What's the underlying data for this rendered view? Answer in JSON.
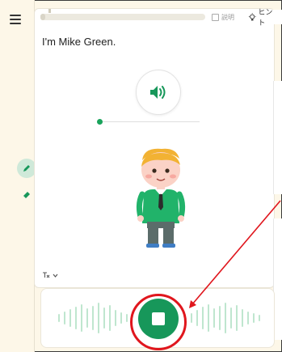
{
  "header": {
    "progress_fraction": 0.03,
    "explain_label": "説明",
    "hint_label": "ヒント"
  },
  "lesson": {
    "sentence": "I'm Mike Green.",
    "audio_position_fraction": 0.02
  },
  "tools": {
    "menu_icon": "hamburger-icon",
    "pen_icon": "pen-icon",
    "eraser_icon": "eraser-icon"
  },
  "language_toggle": {
    "icon": "translate-icon",
    "chevron": "chevron-down-icon"
  },
  "recorder": {
    "state_icon": "stop-icon"
  },
  "colors": {
    "accent_green": "#17975a",
    "annotation_red": "#e0161d",
    "background": "#fdf7e8"
  }
}
